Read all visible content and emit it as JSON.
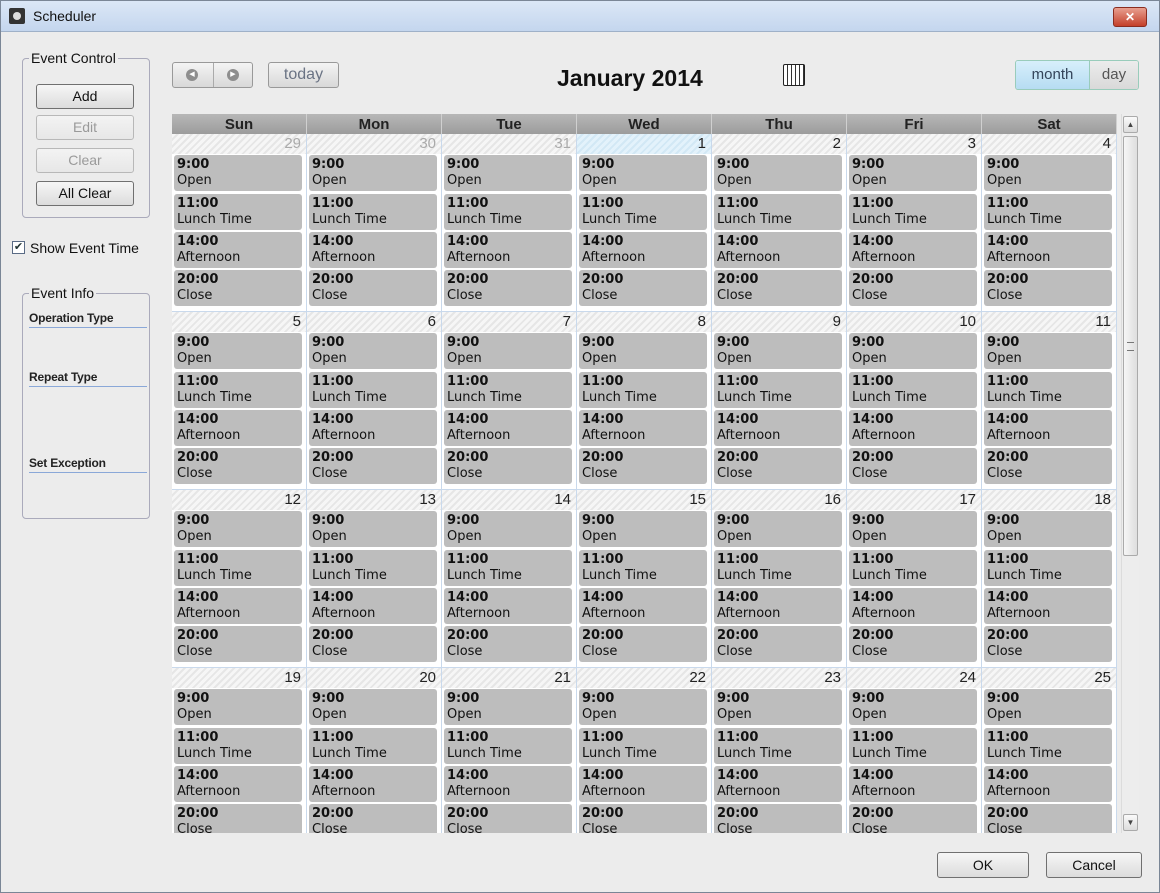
{
  "window": {
    "title": "Scheduler",
    "close_icon": "close-icon"
  },
  "event_control": {
    "label": "Event Control",
    "buttons": [
      {
        "label": "Add",
        "enabled": true
      },
      {
        "label": "Edit",
        "enabled": false
      },
      {
        "label": "Clear",
        "enabled": false
      },
      {
        "label": "All Clear",
        "enabled": true
      }
    ]
  },
  "show_event_time": {
    "label": "Show Event Time",
    "checked": true
  },
  "event_info": {
    "label": "Event Info",
    "operation_type_label": "Operation Type",
    "repeat_type_label": "Repeat Type",
    "set_exception_label": "Set Exception"
  },
  "toolbar": {
    "prev_icon": "chevron-left-icon",
    "next_icon": "chevron-right-icon",
    "today_label": "today",
    "month_title": "January 2014",
    "calendar_icon": "calendar-icon",
    "view_month_label": "month",
    "view_day_label": "day",
    "active_view": "month"
  },
  "calendar": {
    "weekdays": [
      "Sun",
      "Mon",
      "Tue",
      "Wed",
      "Thu",
      "Fri",
      "Sat"
    ],
    "weeks": [
      [
        "29",
        "30",
        "31",
        "1",
        "2",
        "3",
        "4"
      ],
      [
        "5",
        "6",
        "7",
        "8",
        "9",
        "10",
        "11"
      ],
      [
        "12",
        "13",
        "14",
        "15",
        "16",
        "17",
        "18"
      ],
      [
        "19",
        "20",
        "21",
        "22",
        "23",
        "24",
        "25"
      ]
    ],
    "other_month_days": [
      "29",
      "30",
      "31"
    ],
    "highlighted_day": "1",
    "events": [
      {
        "time": "9:00",
        "title": "Open"
      },
      {
        "time": "11:00",
        "title": "Lunch Time"
      },
      {
        "time": "14:00",
        "title": "Afternoon"
      },
      {
        "time": "20:00",
        "title": "Close"
      }
    ]
  },
  "footer": {
    "ok_label": "OK",
    "cancel_label": "Cancel"
  }
}
